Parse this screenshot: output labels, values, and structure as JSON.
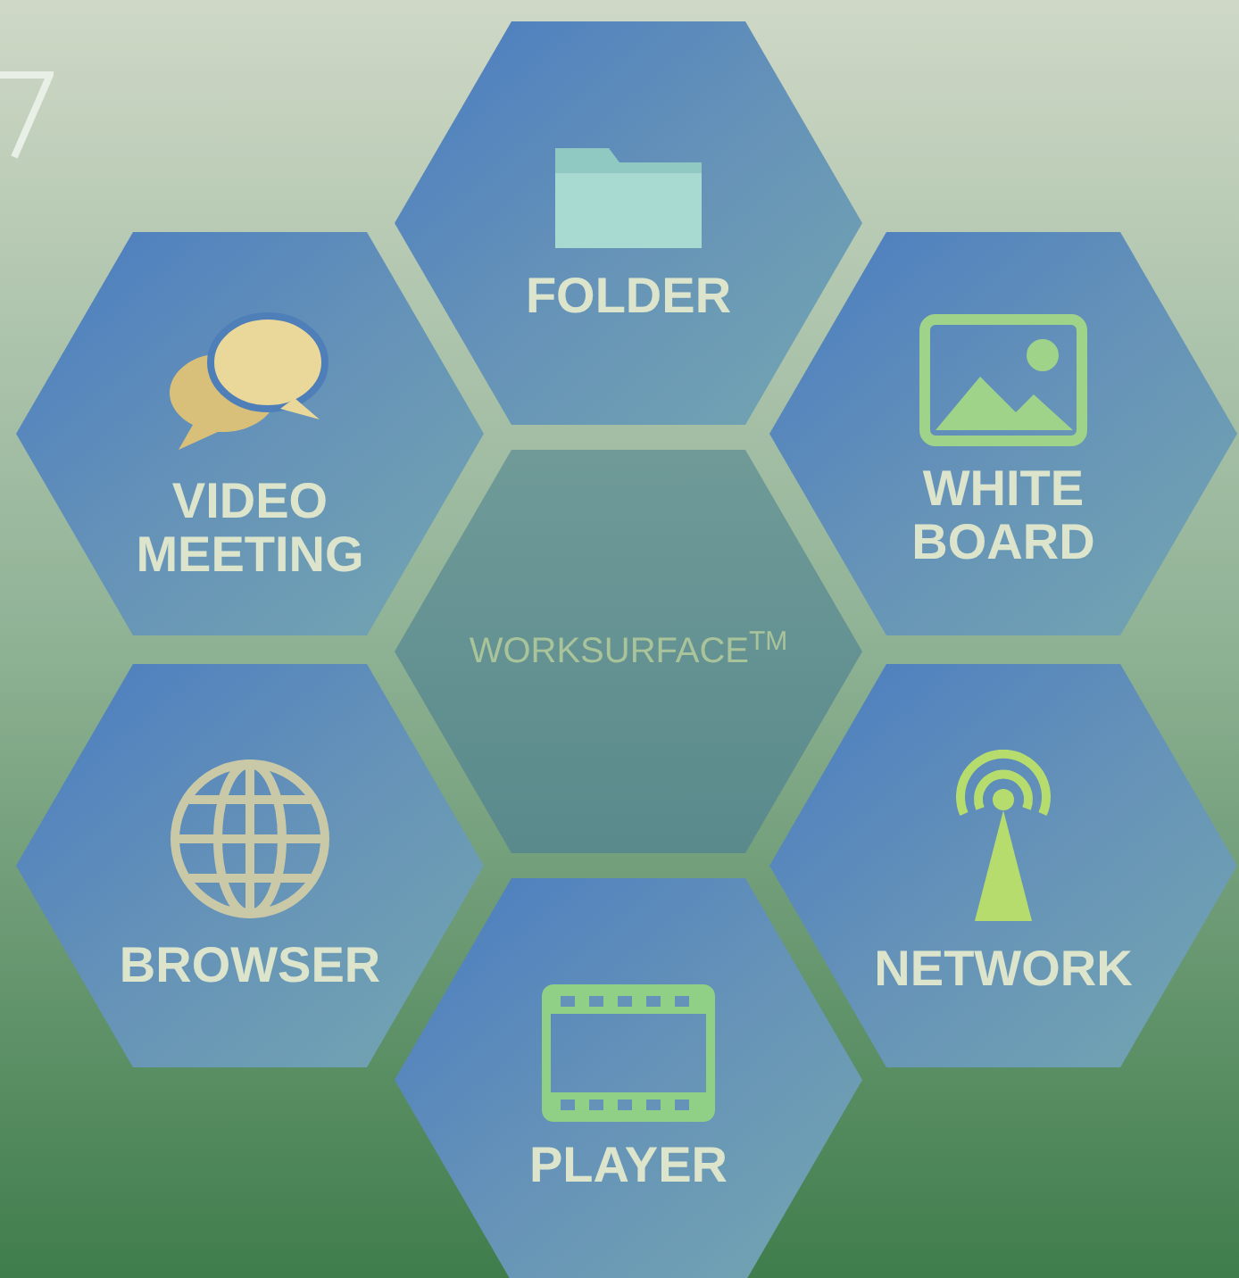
{
  "tiles": [
    {
      "kind": "folder",
      "label": "FOLDER"
    },
    {
      "kind": "chat",
      "label": "VIDEO\nMEETING"
    },
    {
      "kind": "image",
      "label": "WHITE\nBOARD"
    },
    {
      "kind": "center",
      "label": "WORKSURFACE$^{TM}$"
    },
    {
      "kind": "globe",
      "label": "BROWSER"
    },
    {
      "kind": "antenna",
      "label": "NETWORK"
    },
    {
      "kind": "film",
      "label": "PLAYER"
    }
  ]
}
